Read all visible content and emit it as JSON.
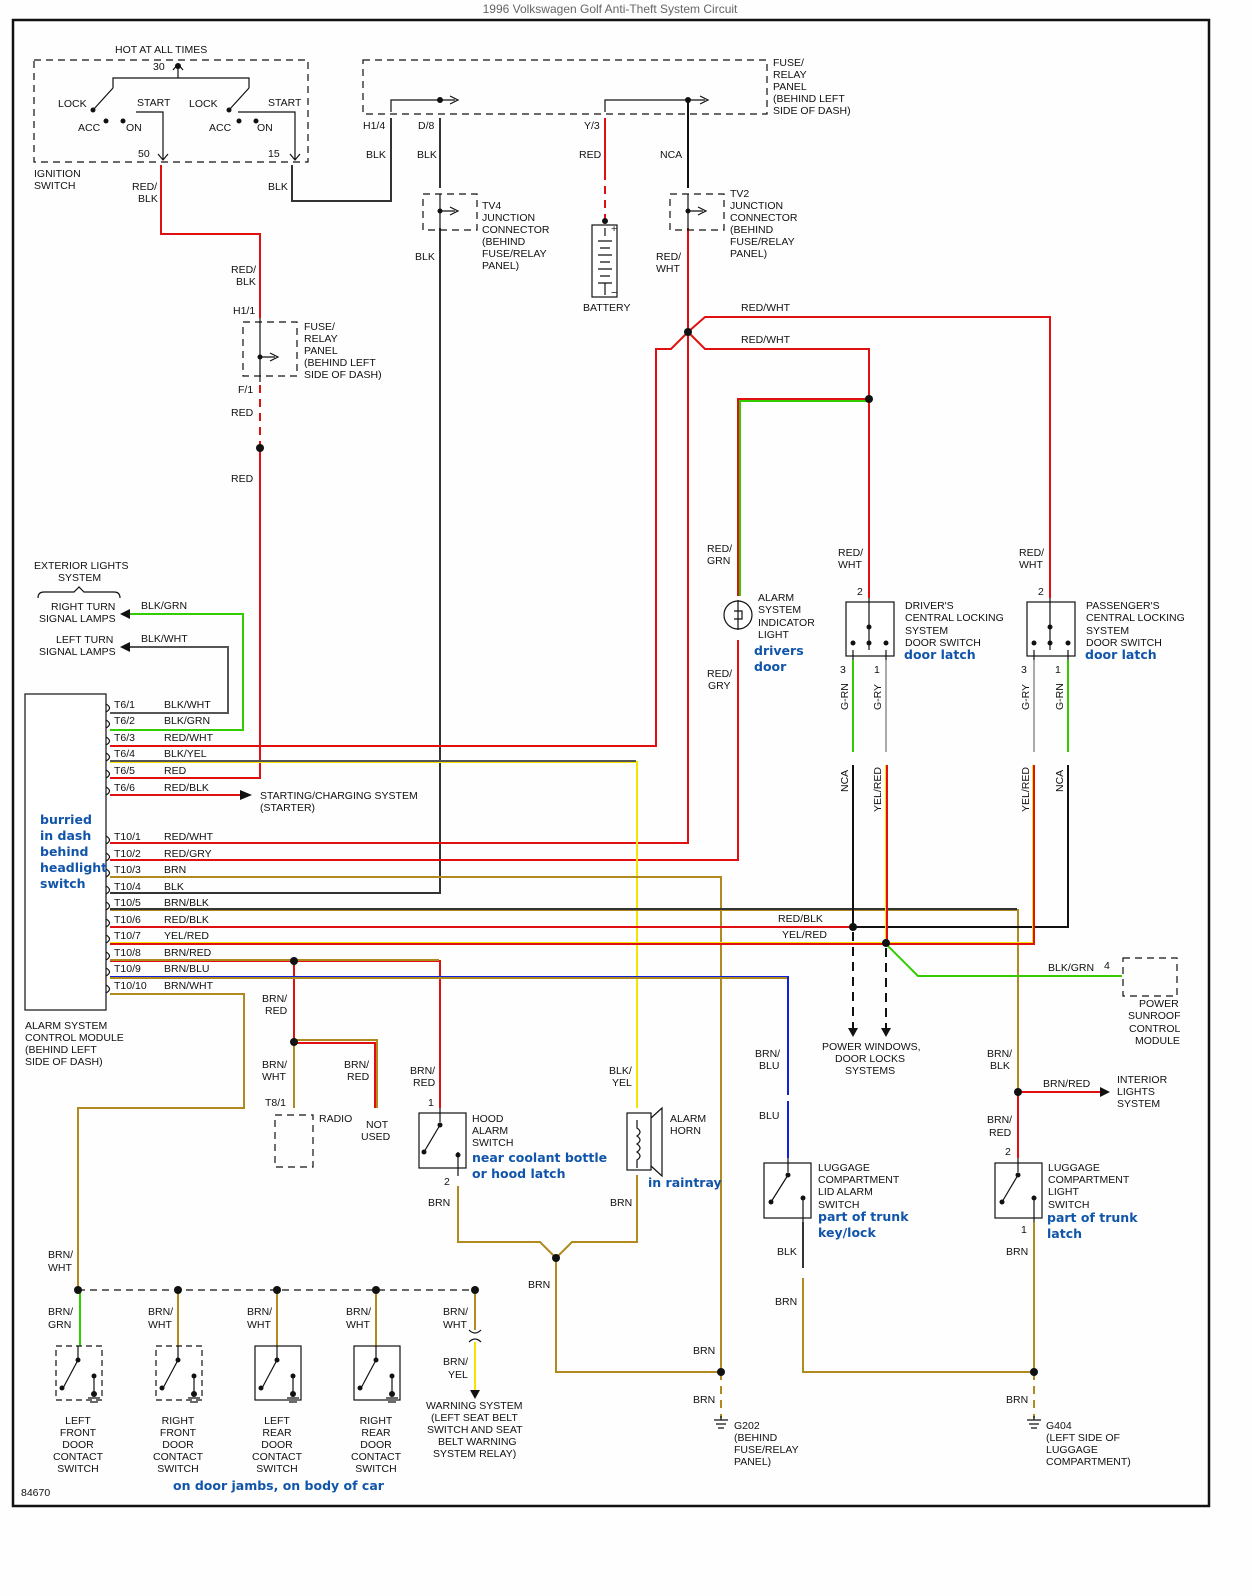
{
  "title": "1996 Volkswagen Golf Anti-Theft System Circuit",
  "figure_id": "84670",
  "ignition": {
    "label_top": "HOT AT ALL TIMES",
    "pin_30": "30",
    "pin_50": "50",
    "pin_15": "15",
    "positions": [
      "LOCK",
      "ACC",
      "ON",
      "START",
      "LOCK",
      "ACC",
      "ON",
      "START"
    ],
    "name": [
      "IGNITION",
      "SWITCH"
    ],
    "wire_50": [
      "RED/",
      "BLK"
    ],
    "wire_15": "BLK"
  },
  "fuse_panel_top": {
    "name": [
      "FUSE/",
      "RELAY",
      "PANEL",
      "(BEHIND LEFT",
      "SIDE OF DASH)"
    ],
    "pins": [
      "H1/4",
      "D/8",
      "Y/3"
    ],
    "wires": [
      "BLK",
      "BLK",
      "RED",
      "NCA"
    ]
  },
  "tv4": {
    "name": [
      "TV4",
      "JUNCTION",
      "CONNECTOR",
      "(BEHIND",
      "FUSE/RELAY",
      "PANEL)"
    ],
    "wire_out": "BLK"
  },
  "tv2": {
    "name": [
      "TV2",
      "JUNCTION",
      "CONNECTOR",
      "(BEHIND",
      "FUSE/RELAY",
      "PANEL)"
    ],
    "wire_out": [
      "RED/",
      "WHT"
    ]
  },
  "battery": {
    "label": "BATTERY",
    "plus": "+",
    "minus": "−"
  },
  "fuse_panel_left": {
    "name": [
      "FUSE/",
      "RELAY",
      "PANEL",
      "(BEHIND LEFT",
      "SIDE OF DASH)"
    ],
    "pin_in": "H1/1",
    "pin_out": "F/1",
    "wire_in": [
      "RED/",
      "BLK"
    ],
    "wire_out": "RED",
    "wire_out2": "RED"
  },
  "red_wht_branches": [
    "RED/WHT",
    "RED/WHT"
  ],
  "indicator_light": {
    "name": [
      "ALARM",
      "SYSTEM",
      "INDICATOR",
      "LIGHT"
    ],
    "note": [
      "drivers",
      "door"
    ],
    "wire_in": [
      "RED/",
      "GRN"
    ],
    "wire_out": [
      "RED/",
      "GRY"
    ]
  },
  "driver_switch": {
    "name": [
      "DRIVER'S",
      "CENTRAL LOCKING",
      "SYSTEM",
      "DOOR SWITCH"
    ],
    "note": "door latch",
    "wire_in": [
      "RED/",
      "WHT"
    ],
    "pin_in": "2",
    "pin_3": "3",
    "pin_1": "1",
    "wire_3": "G-RN",
    "wire_1": "G-RY",
    "wire_3b": "NCA",
    "wire_1b": "YEL/RED"
  },
  "passenger_switch": {
    "name": [
      "PASSENGER'S",
      "CENTRAL LOCKING",
      "SYSTEM",
      "DOOR SWITCH"
    ],
    "note": "door latch",
    "wire_in": [
      "RED/",
      "WHT"
    ],
    "pin_in": "2",
    "pin_3": "3",
    "pin_1": "1",
    "wire_3": "G-RY",
    "wire_1": "G-RN",
    "wire_3b": "YEL/RED",
    "wire_1b": "NCA"
  },
  "exterior_lights": {
    "name": [
      "EXTERIOR LIGHTS",
      "SYSTEM"
    ],
    "right": [
      "RIGHT TURN",
      "SIGNAL LAMPS"
    ],
    "right_wire": "BLK/GRN",
    "left": [
      "LEFT TURN",
      "SIGNAL LAMPS"
    ],
    "left_wire": "BLK/WHT"
  },
  "control_module": {
    "name": [
      "ALARM SYSTEM",
      "CONTROL MODULE",
      "(BEHIND LEFT",
      "SIDE OF DASH)"
    ],
    "note": [
      "burried",
      "in dash",
      "behind",
      "headlight",
      "switch"
    ],
    "pins": [
      {
        "pin": "T6/1",
        "wire": "BLK/WHT",
        "colors": [
          "#555555",
          "#dddddd"
        ]
      },
      {
        "pin": "T6/2",
        "wire": "BLK/GRN",
        "colors": [
          "#333333",
          "#33cc00"
        ]
      },
      {
        "pin": "T6/3",
        "wire": "RED/WHT",
        "colors": [
          "#e01010",
          "#dddddd"
        ]
      },
      {
        "pin": "T6/4",
        "wire": "BLK/YEL",
        "colors": [
          "#555555",
          "#f5e400"
        ]
      },
      {
        "pin": "T6/5",
        "wire": "RED",
        "colors": [
          "#e01010",
          "#e01010"
        ]
      },
      {
        "pin": "T6/6",
        "wire": "RED/BLK",
        "colors": [
          "#e01010",
          "#333333"
        ]
      },
      {
        "pin": "T10/1",
        "wire": "RED/WHT",
        "colors": [
          "#e01010",
          "#dddddd"
        ]
      },
      {
        "pin": "T10/2",
        "wire": "RED/GRY",
        "colors": [
          "#e01010",
          "#aaaaaa"
        ]
      },
      {
        "pin": "T10/3",
        "wire": "BRN",
        "colors": [
          "#b08a1e",
          "#b08a1e"
        ]
      },
      {
        "pin": "T10/4",
        "wire": "BLK",
        "colors": [
          "#333333",
          "#333333"
        ]
      },
      {
        "pin": "T10/5",
        "wire": "BRN/BLK",
        "colors": [
          "#b08a1e",
          "#333333"
        ]
      },
      {
        "pin": "T10/6",
        "wire": "RED/BLK",
        "colors": [
          "#e01010",
          "#333333"
        ]
      },
      {
        "pin": "T10/7",
        "wire": "YEL/RED",
        "colors": [
          "#f5e400",
          "#e01010"
        ]
      },
      {
        "pin": "T10/8",
        "wire": "BRN/RED",
        "colors": [
          "#b08a1e",
          "#e01010"
        ]
      },
      {
        "pin": "T10/9",
        "wire": "BRN/BLU",
        "colors": [
          "#b08a1e",
          "#1020dd"
        ]
      },
      {
        "pin": "T10/10",
        "wire": "BRN/WHT",
        "colors": [
          "#b08a1e",
          "#dddddd"
        ]
      }
    ]
  },
  "starter": [
    "STARTING/CHARGING SYSTEM",
    "(STARTER)"
  ],
  "bus_labels": {
    "red_blk": "RED/BLK",
    "yel_red": "YEL/RED",
    "blk_grn": "BLK/GRN",
    "pin4": "4"
  },
  "sunroof": [
    "POWER",
    "SUNROOF",
    "CONTROL",
    "MODULE"
  ],
  "power_windows": [
    "POWER WINDOWS,",
    "DOOR LOCKS",
    "SYSTEMS"
  ],
  "radio": {
    "label": "RADIO",
    "pin": "T8/1",
    "wire_a": [
      "BRN/",
      "RED"
    ],
    "wire_b": [
      "BRN/",
      "WHT"
    ],
    "wire_c": [
      "BRN/",
      "RED"
    ],
    "not_used": [
      "NOT",
      "USED"
    ]
  },
  "hood_switch": {
    "name": [
      "HOOD",
      "ALARM",
      "SWITCH"
    ],
    "note": [
      "near coolant bottle",
      "or hood latch"
    ],
    "wire_in": [
      "BRN/",
      "RED"
    ],
    "pin_1": "1",
    "pin_2": "2",
    "wire_out": "BRN"
  },
  "horn": {
    "name": [
      "ALARM",
      "HORN"
    ],
    "note": "in raintray",
    "wire_in": [
      "BLK/",
      "YEL"
    ],
    "wire_out": "BRN"
  },
  "lid_switch": {
    "name": [
      "LUGGAGE",
      "COMPARTMENT",
      "LID ALARM",
      "SWITCH"
    ],
    "note": [
      "part of trunk",
      "key/lock"
    ],
    "wire_in": [
      "BRN/",
      "BLU"
    ],
    "wire_mid": "BLU",
    "wire_out": "BLK",
    "wire_out2": "BRN"
  },
  "light_switch": {
    "name": [
      "LUGGAGE",
      "COMPARTMENT",
      "LIGHT",
      "SWITCH"
    ],
    "note": [
      "part of trunk",
      "latch"
    ],
    "wire_in": [
      "BRN/",
      "BLK"
    ],
    "wire_branch": "BRN/RED",
    "wire_in2": [
      "BRN/",
      "RED"
    ],
    "pin_2": "2",
    "pin_1": "1",
    "wire_out": "BRN"
  },
  "interior_lights": [
    "INTERIOR",
    "LIGHTS",
    "SYSTEM"
  ],
  "ground_wires": {
    "mid": "BRN",
    "g202_in": "BRN",
    "g202_out": "BRN",
    "g404_out": "BRN"
  },
  "g202": [
    "G202",
    "(BEHIND",
    "FUSE/RELAY",
    "PANEL)"
  ],
  "g404": [
    "G404",
    "(LEFT SIDE OF",
    "LUGGAGE",
    "COMPARTMENT)"
  ],
  "door_bus": {
    "wire_in": [
      "BRN/",
      "WHT"
    ]
  },
  "door_switches": [
    {
      "wire": [
        "BRN/",
        "GRN"
      ],
      "name": [
        "LEFT",
        "FRONT",
        "DOOR",
        "CONTACT",
        "SWITCH"
      ]
    },
    {
      "wire": [
        "BRN/",
        "WHT"
      ],
      "name": [
        "RIGHT",
        "FRONT",
        "DOOR",
        "CONTACT",
        "SWITCH"
      ]
    },
    {
      "wire": [
        "BRN/",
        "WHT"
      ],
      "name": [
        "LEFT",
        "REAR",
        "DOOR",
        "CONTACT",
        "SWITCH"
      ]
    },
    {
      "wire": [
        "BRN/",
        "WHT"
      ],
      "name": [
        "RIGHT",
        "REAR",
        "DOOR",
        "CONTACT",
        "SWITCH"
      ]
    }
  ],
  "warning_system": {
    "wire_a": [
      "BRN/",
      "WHT"
    ],
    "wire_b": [
      "BRN/",
      "YEL"
    ],
    "name": [
      "WARNING SYSTEM",
      "(LEFT SEAT BELT",
      "SWITCH AND SEAT",
      "BELT WARNING",
      "SYSTEM RELAY)"
    ]
  },
  "door_note": "on door jambs, on body of car"
}
